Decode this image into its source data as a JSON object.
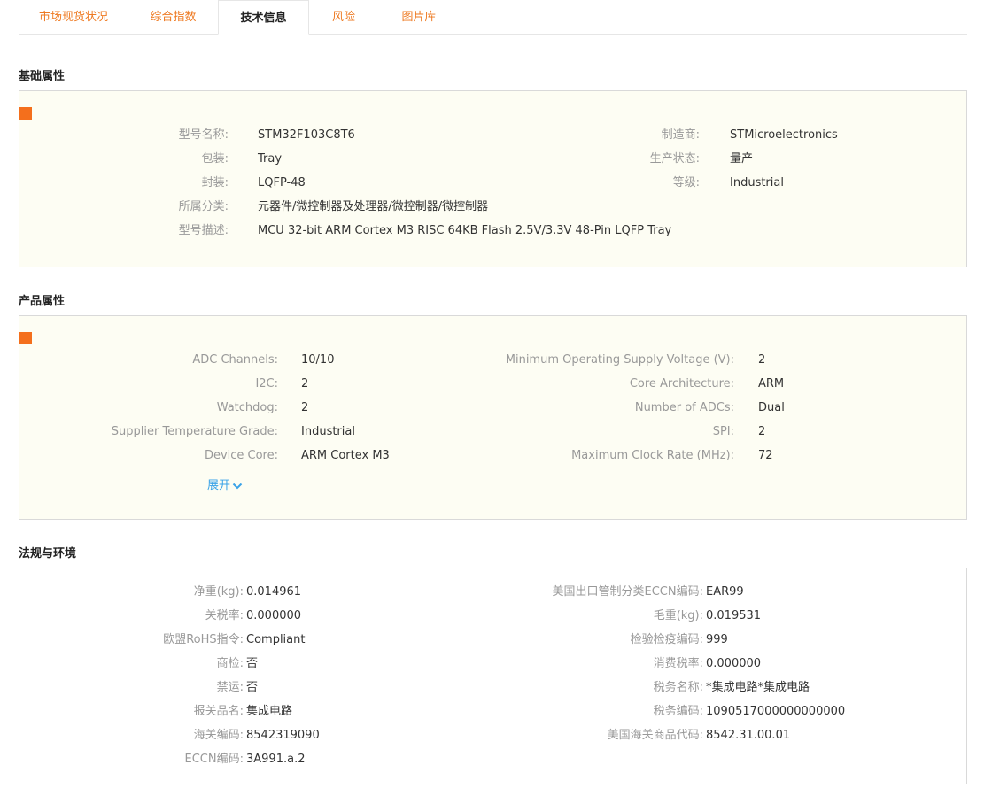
{
  "tabs": [
    {
      "label": "市场现货状况",
      "active": false
    },
    {
      "label": "综合指数",
      "active": false
    },
    {
      "label": "技术信息",
      "active": true
    },
    {
      "label": "风险",
      "active": false
    },
    {
      "label": "图片库",
      "active": false
    }
  ],
  "basic": {
    "title": "基础属性",
    "left": [
      {
        "label": "型号名称:",
        "value": "STM32F103C8T6"
      },
      {
        "label": "包装:",
        "value": "Tray"
      },
      {
        "label": "封装:",
        "value": "LQFP-48"
      },
      {
        "label": "所属分类:",
        "value": "元器件/微控制器及处理器/微控制器/微控制器"
      },
      {
        "label": "型号描述:",
        "value": "MCU 32-bit ARM Cortex M3 RISC 64KB Flash 2.5V/3.3V 48-Pin LQFP Tray"
      }
    ],
    "right": [
      {
        "label": "制造商:",
        "value": "STMicroelectronics"
      },
      {
        "label": "生产状态:",
        "value": "量产"
      },
      {
        "label": "等级:",
        "value": "Industrial"
      }
    ]
  },
  "product": {
    "title": "产品属性",
    "left": [
      {
        "label": "ADC Channels:",
        "value": "10/10"
      },
      {
        "label": "I2C:",
        "value": "2"
      },
      {
        "label": "Watchdog:",
        "value": "2"
      },
      {
        "label": "Supplier Temperature Grade:",
        "value": "Industrial"
      },
      {
        "label": "Device Core:",
        "value": "ARM Cortex M3"
      }
    ],
    "right": [
      {
        "label": "Minimum Operating Supply Voltage (V):",
        "value": "2"
      },
      {
        "label": "Core Architecture:",
        "value": "ARM"
      },
      {
        "label": "Number of ADCs:",
        "value": "Dual"
      },
      {
        "label": "SPI:",
        "value": "2"
      },
      {
        "label": "Maximum Clock Rate (MHz):",
        "value": "72"
      }
    ],
    "expand_label": "展开"
  },
  "regulation": {
    "title": "法规与环境",
    "left": [
      {
        "label": "净重(kg):",
        "value": "0.014961"
      },
      {
        "label": "关税率:",
        "value": "0.000000"
      },
      {
        "label": "欧盟RoHS指令:",
        "value": "Compliant"
      },
      {
        "label": "商检:",
        "value": "否"
      },
      {
        "label": "禁运:",
        "value": "否"
      },
      {
        "label": "报关品名:",
        "value": "集成电路"
      },
      {
        "label": "海关编码:",
        "value": "8542319090"
      },
      {
        "label": "ECCN编码:",
        "value": "3A991.a.2"
      }
    ],
    "right": [
      {
        "label": "美国出口管制分类ECCN编码:",
        "value": "EAR99"
      },
      {
        "label": "毛重(kg):",
        "value": "0.019531"
      },
      {
        "label": "检验检疫编码:",
        "value": "999"
      },
      {
        "label": "消费税率:",
        "value": "0.000000"
      },
      {
        "label": "税务名称:",
        "value": "*集成电路*集成电路"
      },
      {
        "label": "税务编码:",
        "value": "1090517000000000000"
      },
      {
        "label": "美国海关商品代码:",
        "value": "8542.31.00.01"
      }
    ]
  },
  "colors": {
    "accent": "#f46f1c",
    "tab_text": "#ee7a22",
    "link": "#3aa3e8",
    "panel_bg": "#fdfdf3"
  }
}
